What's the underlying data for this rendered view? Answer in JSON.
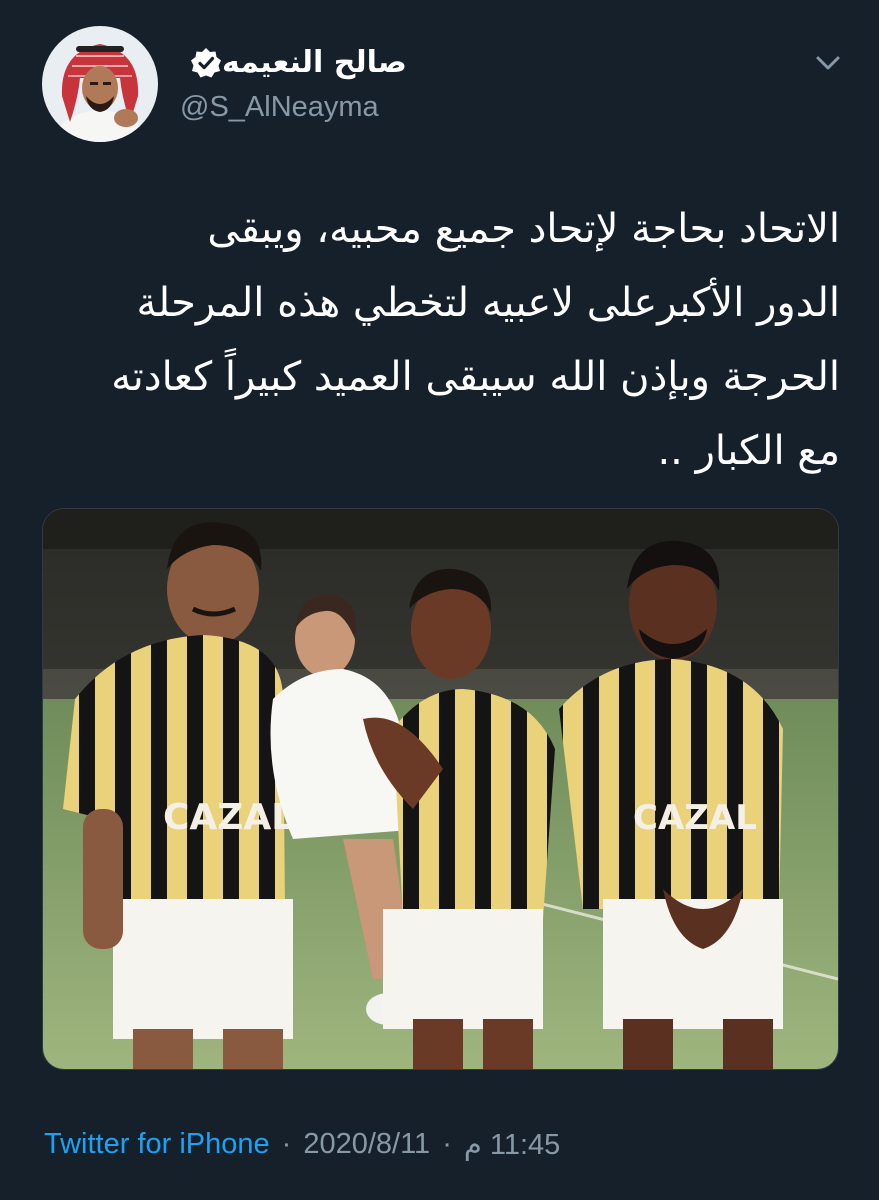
{
  "author": {
    "display_name": "صالح النعيمه",
    "handle": "@S_AlNeayma",
    "verified": true,
    "avatar_icon": "profile-avatar"
  },
  "tweet": {
    "lines": [
      "الاتحاد بحاجة لإتحاد جميع محبيه، ويبقى",
      "الدور الأكبرعلى لاعبيه لتخطي هذه المرحلة",
      "الحرجة وبإذن الله سيبقى العميد كبيراً كعادته",
      "مع الكبار .."
    ],
    "media_icon": "team-photo",
    "jersey_text": "CAZAL"
  },
  "meta": {
    "source": "Twitter for iPhone",
    "date": "2020/8/11",
    "time": "11:45 م",
    "separator": "·"
  },
  "colors": {
    "background": "#15202b",
    "text": "#ffffff",
    "secondary": "#8899a6",
    "accent": "#1da1f2"
  },
  "icons": {
    "verified": "verified-badge-icon",
    "menu": "chevron-down-icon"
  }
}
